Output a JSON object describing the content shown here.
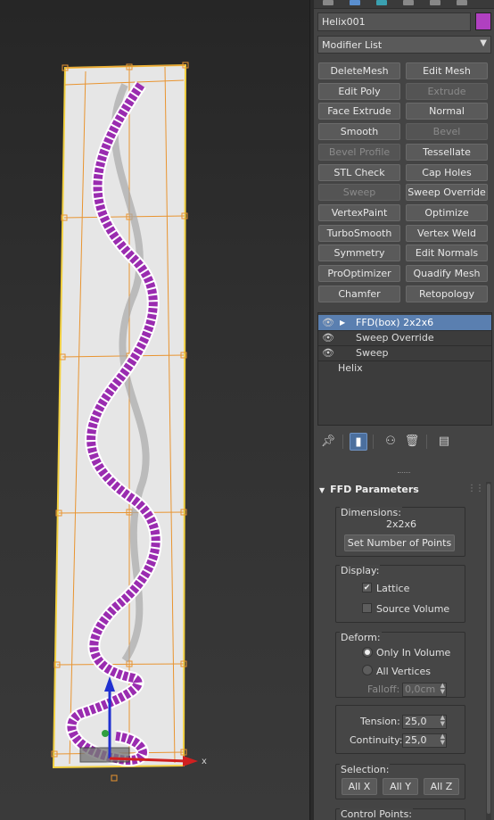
{
  "object": {
    "name": "Helix001",
    "color": "#b040c0"
  },
  "modifier_list": {
    "label": "Modifier List"
  },
  "modifier_buttons": [
    {
      "label": "DeleteMesh",
      "enabled": true
    },
    {
      "label": "Edit Mesh",
      "enabled": true
    },
    {
      "label": "Edit Poly",
      "enabled": true
    },
    {
      "label": "Extrude",
      "enabled": false
    },
    {
      "label": "Face Extrude",
      "enabled": true
    },
    {
      "label": "Normal",
      "enabled": true
    },
    {
      "label": "Smooth",
      "enabled": true
    },
    {
      "label": "Bevel",
      "enabled": false
    },
    {
      "label": "Bevel Profile",
      "enabled": false
    },
    {
      "label": "Tessellate",
      "enabled": true
    },
    {
      "label": "STL Check",
      "enabled": true
    },
    {
      "label": "Cap Holes",
      "enabled": true
    },
    {
      "label": "Sweep",
      "enabled": false
    },
    {
      "label": "Sweep Override",
      "enabled": true
    },
    {
      "label": "VertexPaint",
      "enabled": true
    },
    {
      "label": "Optimize",
      "enabled": true
    },
    {
      "label": "TurboSmooth",
      "enabled": true
    },
    {
      "label": "Vertex Weld",
      "enabled": true
    },
    {
      "label": "Symmetry",
      "enabled": true
    },
    {
      "label": "Edit Normals",
      "enabled": true
    },
    {
      "label": "ProOptimizer",
      "enabled": true
    },
    {
      "label": "Quadify Mesh",
      "enabled": true
    },
    {
      "label": "Chamfer",
      "enabled": true
    },
    {
      "label": "Retopology",
      "enabled": true
    }
  ],
  "stack": [
    {
      "label": "FFD(box) 2x2x6",
      "selected": true,
      "has_eye": true,
      "expandable": true
    },
    {
      "label": "Sweep Override",
      "selected": false,
      "has_eye": true,
      "expandable": false
    },
    {
      "label": "Sweep",
      "selected": false,
      "has_eye": true,
      "expandable": false
    },
    {
      "label": "Helix",
      "selected": false,
      "has_eye": false,
      "expandable": false
    }
  ],
  "stack_tools": [
    "pin-stack-icon",
    "show-end-result-icon",
    "make-unique-icon",
    "remove-modifier-icon",
    "configure-modifier-sets-icon"
  ],
  "ffd": {
    "title": "FFD Parameters",
    "dimensions": {
      "title": "Dimensions:",
      "value": "2x2x6",
      "set_points_label": "Set Number of Points"
    },
    "display": {
      "title": "Display:",
      "lattice_label": "Lattice",
      "lattice_checked": true,
      "source_volume_label": "Source Volume",
      "source_volume_checked": false
    },
    "deform": {
      "title": "Deform:",
      "only_in_volume_label": "Only In Volume",
      "all_vertices_label": "All Vertices",
      "mode": "only_in_volume",
      "falloff_label": "Falloff:",
      "falloff_value": "0,0cm"
    },
    "tension": {
      "label": "Tension:",
      "value": "25,0"
    },
    "continuity": {
      "label": "Continuity:",
      "value": "25,0"
    },
    "selection": {
      "title": "Selection:",
      "buttons": [
        "All X",
        "All Y",
        "All Z"
      ]
    },
    "control_points": {
      "title": "Control Points:"
    }
  },
  "viewport": {
    "axis_x_label": "x"
  }
}
